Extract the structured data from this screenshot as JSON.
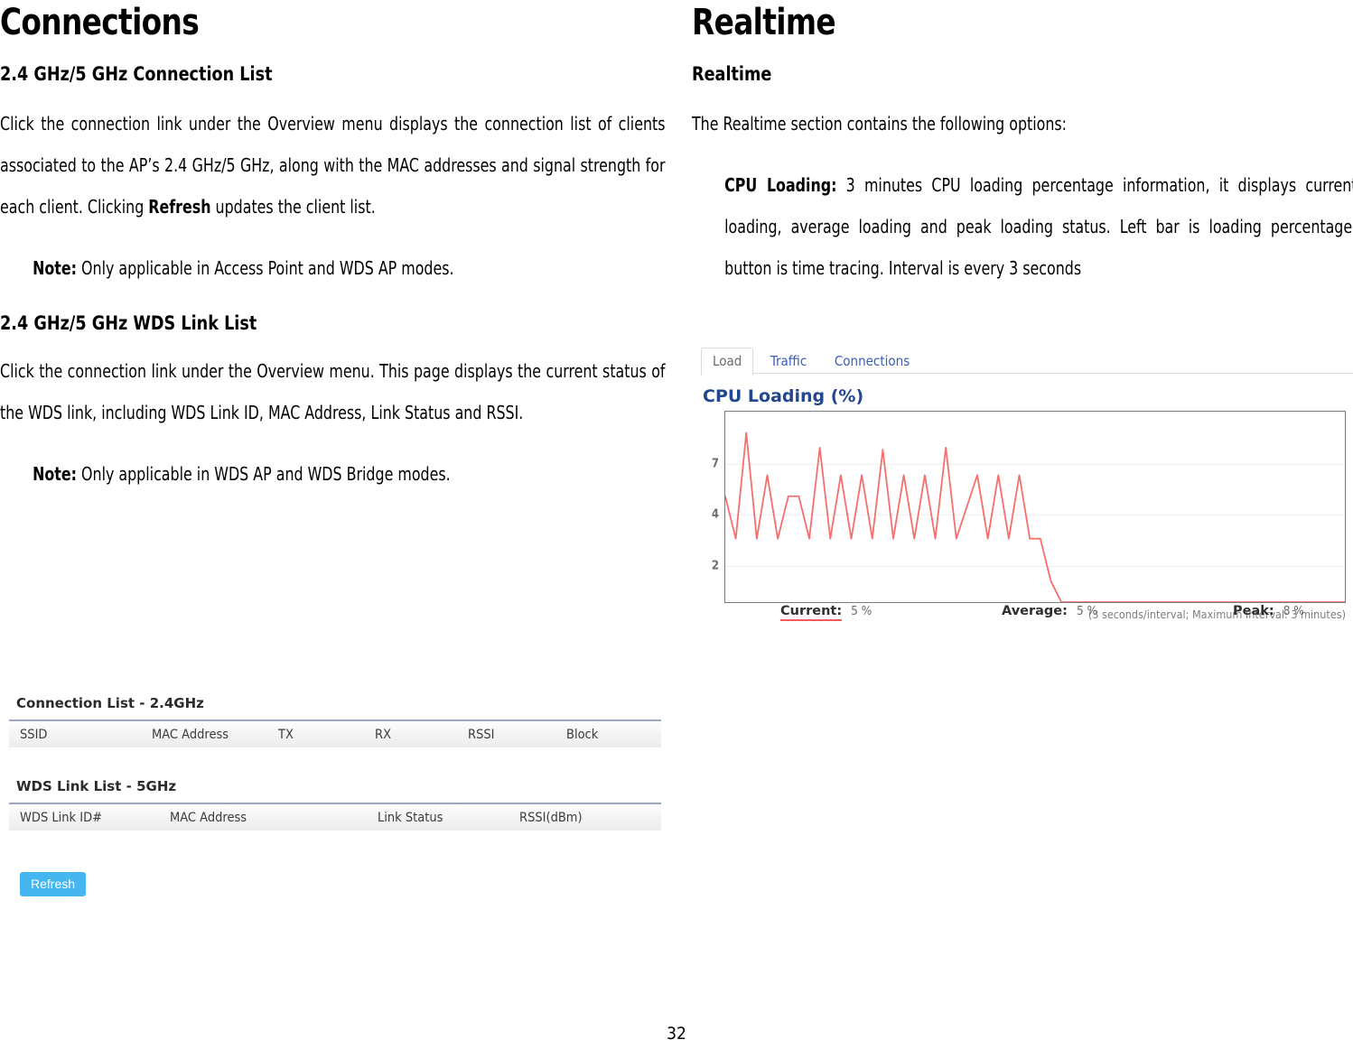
{
  "left": {
    "title": "Connections",
    "section1": {
      "heading": "2.4 GHz/5 GHz Connection List",
      "para_a": "Click the connection link under the Overview menu displays the connection list of clients associated to the AP’s 2.4 GHz/5 GHz, along with the MAC addresses and signal strength for each client. Clicking ",
      "para_bold": "Refresh",
      "para_b": " updates the client list.",
      "note_label": "Note:",
      "note_text": " Only applicable in Access Point and WDS AP modes."
    },
    "section2": {
      "heading": "2.4 GHz/5 GHz WDS Link List",
      "para": "Click the connection link under the Overview menu. This page displays the current status of the WDS link, including WDS Link ID, MAC Address, Link Status and RSSI.",
      "note_label": "Note:",
      "note_text": " Only applicable in WDS AP and WDS Bridge modes."
    },
    "screenshot": {
      "connection_table": {
        "title": "Connection List - 2.4GHz",
        "columns": [
          "SSID",
          "MAC Address",
          "TX",
          "RX",
          "RSSI",
          "Block"
        ],
        "rows": []
      },
      "wds_table": {
        "title": "WDS Link List - 5GHz",
        "columns": [
          "WDS Link ID#",
          "MAC Address",
          "Link Status",
          "RSSI(dBm)"
        ],
        "rows": []
      },
      "refresh_button": "Refresh"
    }
  },
  "right": {
    "title": "Realtime",
    "heading": "Realtime",
    "intro": "The Realtime section contains the following options:",
    "option": {
      "label": "CPU Loading:",
      "text": " 3 minutes CPU loading percentage information, it displays current loading, average loading and peak loading status. Left bar is loading percentage; button is time tracing. Interval is every 3 seconds"
    },
    "screenshot": {
      "tabs": [
        {
          "label": "Load",
          "active": true
        },
        {
          "label": "Traffic",
          "active": false
        },
        {
          "label": "Connections",
          "active": false
        }
      ],
      "interval_note": "(3 seconds/interval; Maximum Interval: 3 minutes)",
      "stats": [
        {
          "label": "Current:",
          "value": "5 %",
          "underlined": true
        },
        {
          "label": "Average:",
          "value": "5 %",
          "underlined": false
        },
        {
          "label": "Peak:",
          "value": "8 %",
          "underlined": false
        }
      ]
    }
  },
  "footer": {
    "page_number": "32"
  },
  "colors": {
    "series_red": "#f4706e",
    "title_blue": "#21488f",
    "tab_link_blue": "#3b5fb5",
    "refresh_blue": "#45b6ef",
    "table_rule": "#9aa6c4"
  },
  "chart_data": {
    "type": "line",
    "title": "CPU Loading (%)",
    "xlabel": "",
    "ylabel": "",
    "grid": true,
    "legend_position": "below",
    "ylim": [
      0,
      9
    ],
    "yticks": [
      2,
      4,
      7
    ],
    "ytick_labels": [
      "2",
      "4",
      "7"
    ],
    "x_interval_seconds": 3,
    "max_interval_minutes": 3,
    "series": [
      {
        "name": "CPU Loading",
        "color": "#f4706e",
        "values": [
          5,
          3,
          8,
          3,
          6,
          3,
          5,
          5,
          3,
          7.3,
          3,
          6,
          3,
          6,
          3,
          7.2,
          3,
          6,
          3,
          6,
          3,
          7.3,
          3,
          4.5,
          6,
          3,
          6,
          3,
          6,
          3,
          3,
          1,
          0,
          0,
          0,
          0,
          0,
          0,
          0,
          0,
          0,
          0,
          0,
          0,
          0,
          0,
          0,
          0,
          0,
          0,
          0,
          0,
          0,
          0,
          0,
          0,
          0,
          0,
          0,
          0
        ]
      }
    ],
    "summary": {
      "current": 5,
      "average": 5,
      "peak": 8,
      "unit": "%"
    }
  }
}
